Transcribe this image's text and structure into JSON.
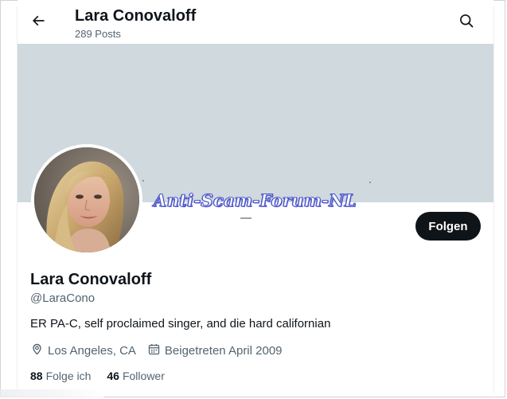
{
  "header": {
    "title": "Lara Conovaloff",
    "posts": "289 Posts",
    "back_icon": "arrow-left-icon",
    "search_icon": "search-icon"
  },
  "banner": {
    "color": "#cfd9de"
  },
  "watermark": {
    "text": "Anti-Scam-Forum-NL",
    "color": "#4a52c9"
  },
  "profile": {
    "display_name": "Lara Conovaloff",
    "handle": "@LaraCono",
    "bio": "ER PA-C, self proclaimed singer, and die hard californian",
    "location": "Los Angeles, CA",
    "joined": "Beigetreten April 2009",
    "location_icon": "location-pin-icon",
    "calendar_icon": "calendar-icon",
    "avatar_icon": "profile-photo"
  },
  "actions": {
    "follow_label": "Folgen",
    "follow_color": "#0f1419"
  },
  "stats": {
    "following_count": "88",
    "following_label": "Folge ich",
    "followers_count": "46",
    "followers_label": "Follower"
  },
  "colors": {
    "text_primary": "#0f1419",
    "text_secondary": "#536471"
  }
}
